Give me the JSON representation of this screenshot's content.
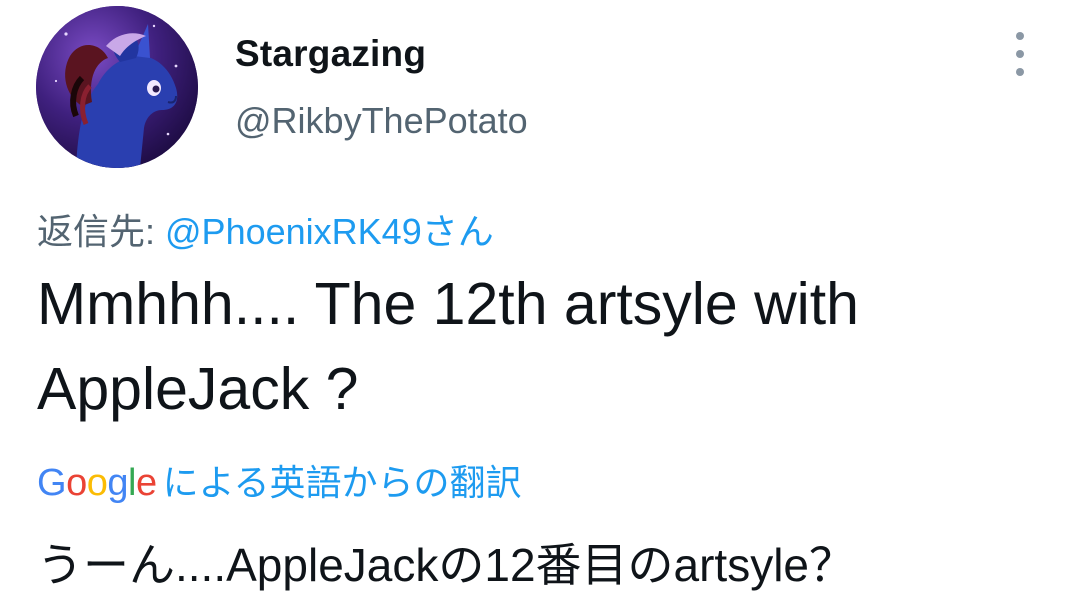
{
  "author": {
    "display_name": "Stargazing",
    "handle": "@RikbyThePotato",
    "avatar_icon": "avatar-pony-icon"
  },
  "menu": {
    "icon": "more-vertical-icon"
  },
  "reply": {
    "prefix": "返信先: ",
    "target": "@PhoenixRK49さん"
  },
  "tweet": {
    "text": "Mmhhh.... The 12th artsyle with\nAppleJack ?"
  },
  "translation": {
    "provider": "Google",
    "label": "による英語からの翻訳",
    "text": "うーん....AppleJackの12番目のartsyle？"
  },
  "colors": {
    "text_primary": "#0f1419",
    "text_secondary": "#536471",
    "link": "#1d9bf0"
  }
}
